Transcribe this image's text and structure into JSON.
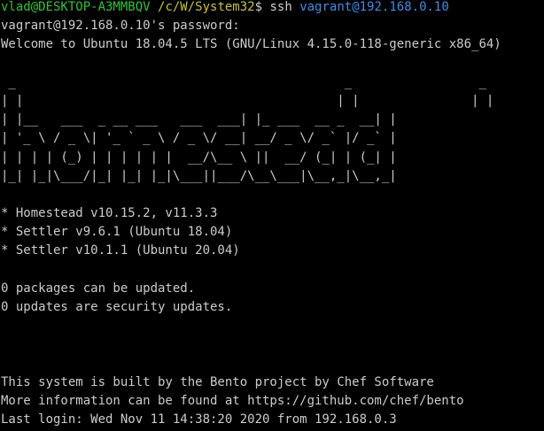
{
  "prompt": {
    "user_host": "vlad@DESKTOP-A3MMBQV",
    "path": "/c/W/System32",
    "symbol": "$",
    "command": "ssh",
    "target": "vagrant@192.168.0.10"
  },
  "password_prompt": "vagrant@192.168.0.10's password:",
  "welcome": "Welcome to Ubuntu 18.04.5 LTS (GNU/Linux 4.15.0-118-generic x86_64)",
  "banner": [
    " _                                            _                 _",
    "| |                                          | |               | |",
    "| |__   ___  _ __ ___   ___  ___| |_ ___  __ _  __| |",
    "| '_ \\ / _ \\| '_ ` _ \\ / _ \\/ __| __/ _ \\/ _` |/ _` |",
    "| | | | (_) | | | | | |  __/\\__ \\ ||  __/ (_| | (_| |",
    "|_| |_|\\___/|_| |_| |_|\\___||___/\\__\\___|\\__,_|\\__,_|"
  ],
  "versions": [
    "* Homestead v10.15.2, v11.3.3",
    "* Settler v9.6.1 (Ubuntu 18.04)",
    "* Settler v10.1.1 (Ubuntu 20.04)"
  ],
  "updates": [
    "0 packages can be updated.",
    "0 updates are security updates."
  ],
  "footer": [
    "This system is built by the Bento project by Chef Software",
    "More information can be found at https://github.com/chef/bento",
    "Last login: Wed Nov 11 14:38:20 2020 from 192.168.0.3"
  ],
  "colors": {
    "background": "#000000",
    "text": "#cccccc",
    "user_host": "#2cc733",
    "path": "#c7c42c",
    "link": "#3b8eea"
  }
}
